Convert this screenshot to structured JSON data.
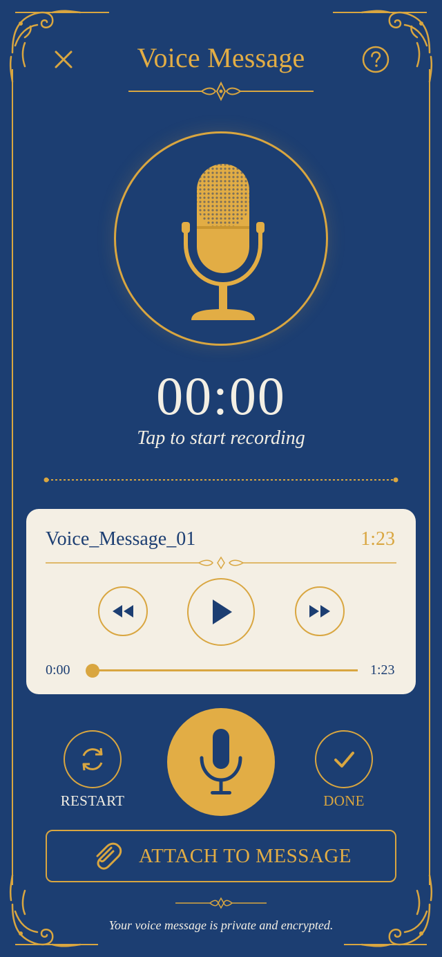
{
  "header": {
    "title": "Voice Message",
    "close_icon": "close-icon",
    "help_icon": "help-icon"
  },
  "recorder": {
    "timer": "00:00",
    "hint": "Tap to start recording",
    "mic_icon": "microphone-icon"
  },
  "card": {
    "title": "Voice_Message_01",
    "duration": "1:23",
    "current_time": "0:00",
    "total_time": "1:23",
    "progress": 0
  },
  "actions": {
    "restart_label": "RESTART",
    "done_label": "DONE",
    "record_icon": "microphone-icon"
  },
  "attach": {
    "label": "ATTACH TO MESSAGE",
    "icon": "paperclip-icon"
  },
  "footer": {
    "text": "Your voice message is private and encrypted."
  },
  "colors": {
    "background": "#1c3e72",
    "gold": "#d9a640",
    "cream": "#f4efe4",
    "text_light": "#f3efe4"
  }
}
